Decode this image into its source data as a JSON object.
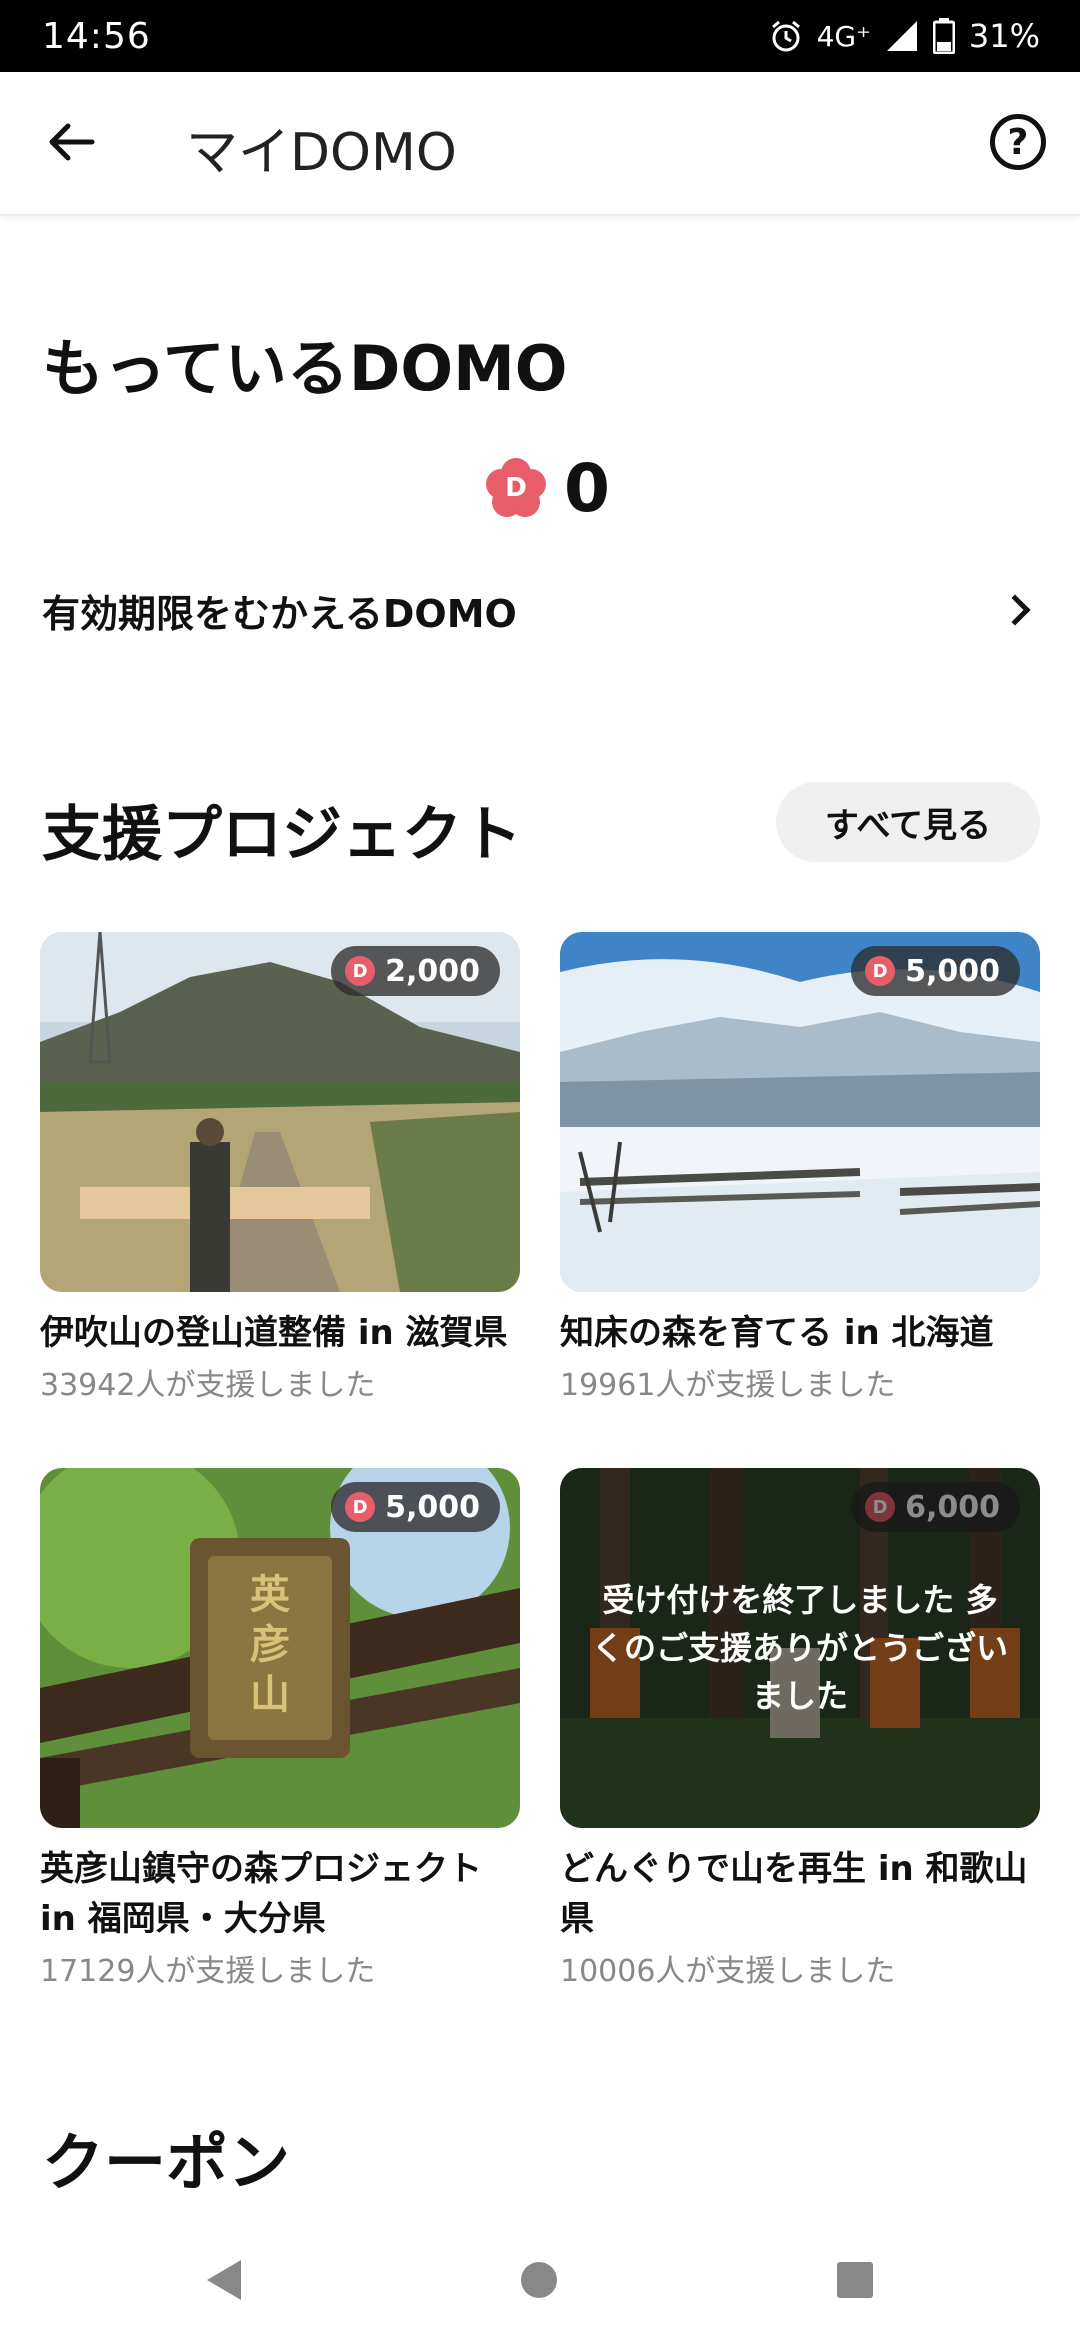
{
  "status_bar": {
    "time": "14:56",
    "network": "4G⁺",
    "battery": "31%"
  },
  "app_bar": {
    "title": "マイDOMO"
  },
  "domo_section": {
    "title": "もっているDOMO",
    "balance": "0",
    "expiring_label": "有効期限をむかえるDOMO"
  },
  "projects_section": {
    "title": "支援プロジェクト",
    "see_all": "すべて見る",
    "projects": [
      {
        "name": "伊吹山の登山道整備 in 滋賀県",
        "supporters": "33942人が支援しました",
        "domo": "2,000"
      },
      {
        "name": "知床の森を育てる in 北海道",
        "supporters": "19961人が支援しました",
        "domo": "5,000"
      },
      {
        "name": "英彦山鎮守の森プロジェクト in 福岡県・大分県",
        "supporters": "17129人が支援しました",
        "domo": "5,000"
      },
      {
        "name": "どんぐりで山を再生 in 和歌山県",
        "supporters": "10006人が支援しました",
        "domo": "6,000",
        "closed_message": "受け付けを終了しました 多くのご支援ありがとうございました"
      }
    ]
  },
  "coupon_section": {
    "title": "クーポン"
  },
  "colors": {
    "domo_accent": "#e85d6a",
    "badge_bg": "#2d2d2d"
  }
}
